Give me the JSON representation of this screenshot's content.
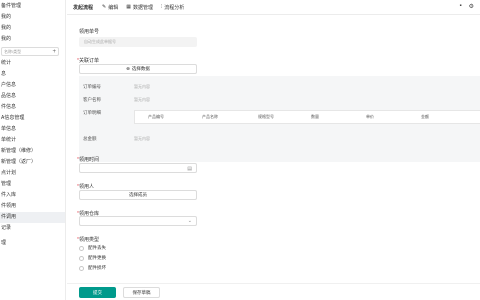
{
  "sidebar": {
    "title": "备件管理",
    "top_items": [
      "我的",
      "我的",
      "我的"
    ],
    "search_placeholder": "名称/类型",
    "items": [
      "统计",
      "息",
      "户信息",
      "品信息",
      "件信息",
      "A信息管理",
      "单信息",
      "单统计",
      "新管理（维修）",
      "新管理（返厂）",
      "点计划",
      "管理",
      "件入库",
      "件领用",
      "件调用",
      "记录"
    ],
    "bottom_item": "理",
    "active_index": 14
  },
  "toolbar": {
    "title": "发起流程",
    "edit": "编辑",
    "data_manage": "数据管理",
    "flow_analysis": "流程分析"
  },
  "form": {
    "apply_no_label": "领用单号",
    "apply_no_placeholder": "自动生成此单据号",
    "order_label": "关联订单",
    "select_data_button": "选择数据",
    "panel": {
      "order_no_label": "订单编号",
      "customer_label": "客户名称",
      "order_detail_label": "订单明细",
      "total_label": "总金额",
      "empty_value": "暂无内容",
      "table_headers": [
        "产品编号",
        "产品名称",
        "规格型号",
        "数量",
        "单价",
        "金额"
      ]
    },
    "time_label": "领用时间",
    "person_label": "领用人",
    "person_button": "选择成员",
    "warehouse_label": "领用仓库",
    "type_label": "领用类型",
    "type_options": [
      "配件丢失",
      "配件更换",
      "配件损坏"
    ]
  },
  "footer": {
    "submit": "提交",
    "save_draft": "保存草稿"
  }
}
